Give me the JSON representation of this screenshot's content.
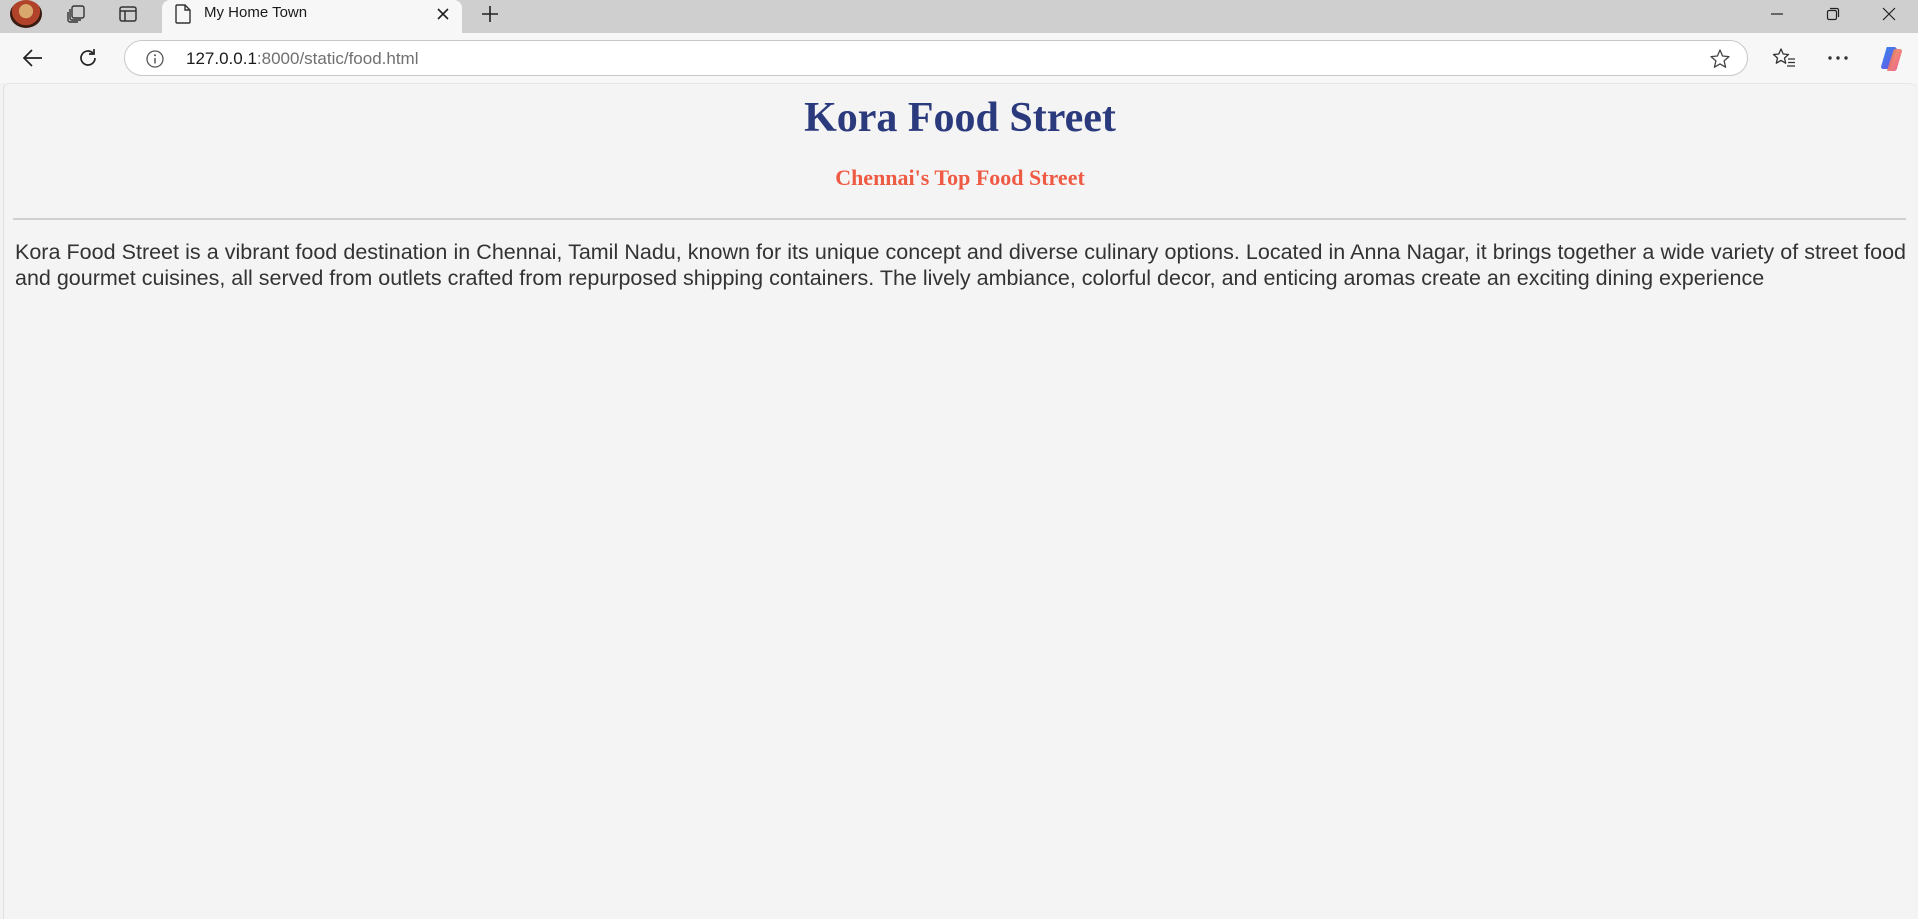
{
  "browser": {
    "tab": {
      "title": "My Home Town"
    },
    "address": {
      "host": "127.0.0.1",
      "path": ":8000/static/food.html"
    }
  },
  "page": {
    "title": "Kora Food Street",
    "subtitle": "Chennai's Top Food Street",
    "body": "Kora Food Street is a vibrant food destination in Chennai, Tamil Nadu, known for its unique concept and diverse culinary options. Located in Anna Nagar, it brings together a wide variety of street food and gourmet cuisines, all served from outlets crafted from repurposed shipping containers. The lively ambiance, colorful decor, and enticing aromas create an exciting dining experience"
  },
  "colors": {
    "title": "#2b3a7d",
    "subtitle": "#ee5a43",
    "body_text": "#333333",
    "page_background": "#f4f4f4",
    "tabstrip_background": "#cfcfcf"
  },
  "icons": {
    "profile": "profile-avatar",
    "workspaces": "workspaces-icon",
    "vertical_tabs": "vertical-tabs-icon",
    "tab_page": "page-icon",
    "tab_close": "close-icon",
    "new_tab": "plus-icon",
    "minimize": "minimize-icon",
    "restore": "restore-icon",
    "window_close": "close-icon",
    "back": "back-arrow-icon",
    "refresh": "refresh-icon",
    "site_info": "info-icon",
    "favorite": "star-icon",
    "favorites": "favorites-icon",
    "more": "more-icon",
    "copilot": "copilot-icon"
  }
}
